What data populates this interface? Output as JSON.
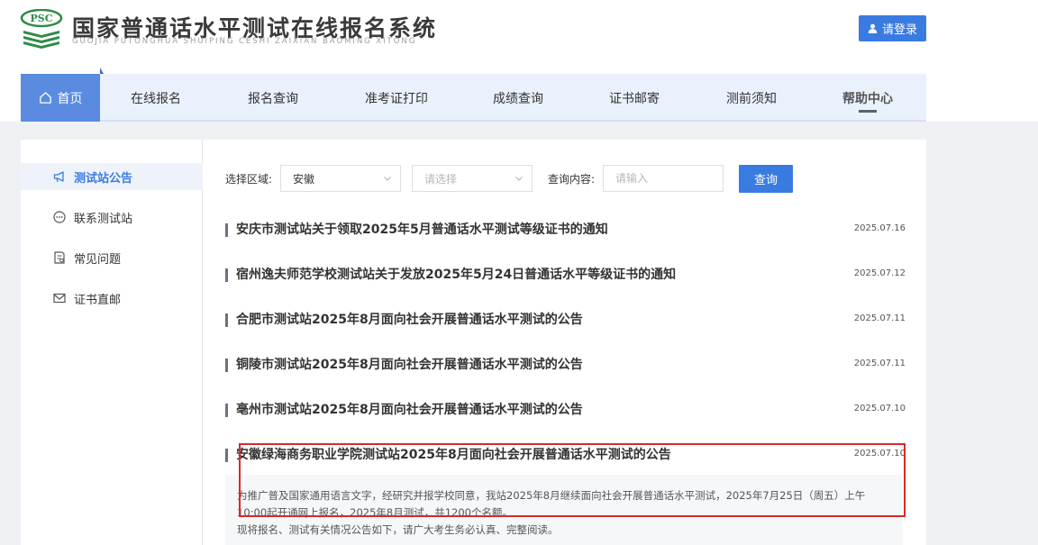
{
  "header": {
    "logo_text": "PSC",
    "title": "国家普通话水平测试在线报名系统",
    "subtitle": "GUOJIA PUTONGHUA SHUIPING CESHI ZAIXIAN BAOMING XITONG",
    "login_label": "请登录"
  },
  "nav": {
    "home_label": "首页",
    "items": [
      {
        "label": "在线报名"
      },
      {
        "label": "报名查询"
      },
      {
        "label": "准考证打印"
      },
      {
        "label": "成绩查询"
      },
      {
        "label": "证书邮寄"
      },
      {
        "label": "测前须知"
      },
      {
        "label": "帮助中心"
      }
    ]
  },
  "sidebar": {
    "items": [
      {
        "label": "测试站公告",
        "icon": "megaphone-icon"
      },
      {
        "label": "联系测试站",
        "icon": "chat-icon"
      },
      {
        "label": "常见问题",
        "icon": "document-icon"
      },
      {
        "label": "证书直邮",
        "icon": "mail-icon"
      }
    ]
  },
  "filters": {
    "region_label": "选择区域:",
    "region_value": "安徽",
    "city_placeholder": "请选择",
    "query_label": "查询内容:",
    "query_placeholder": "请输入",
    "search_label": "查询"
  },
  "news": [
    {
      "title": "安庆市测试站关于领取2025年5月普通话水平测试等级证书的通知",
      "date": "2025.07.16"
    },
    {
      "title": "宿州逸夫师范学校测试站关于发放2025年5月24日普通话水平等级证书的通知",
      "date": "2025.07.12"
    },
    {
      "title": "合肥市测试站2025年8月面向社会开展普通话水平测试的公告",
      "date": "2025.07.11"
    },
    {
      "title": "铜陵市测试站2025年8月面向社会开展普通话水平测试的公告",
      "date": "2025.07.11"
    },
    {
      "title": "亳州市测试站2025年8月面向社会开展普通话水平测试的公告",
      "date": "2025.07.10"
    },
    {
      "title": "安徽绿海商务职业学院测试站2025年8月面向社会开展普通话水平测试的公告",
      "date": "2025.07.10"
    }
  ],
  "summary": {
    "line1": "为推广普及国家通用语言文字，经研究并报学校同意，我站2025年8月继续面向社会开展普通话水平测试，2025年7月25日（周五）上午",
    "line2": "10:00起开通网上报名，2025年8月测试，共1200个名额。",
    "line3": "现将报名、测试有关情况公告如下，请广大考生务必认真、完整阅读。"
  },
  "colors": {
    "accent": "#3a7be2",
    "nav_active": "#5a8be0",
    "highlight": "#d82a2a"
  }
}
